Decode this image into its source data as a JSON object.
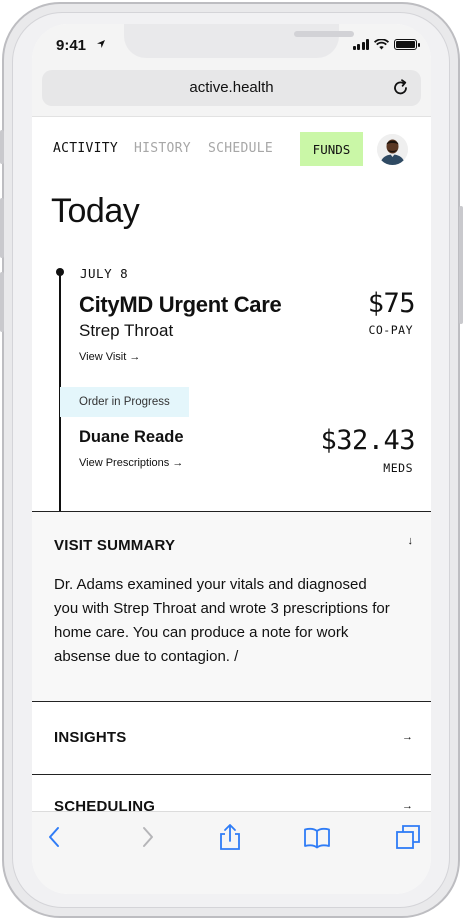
{
  "status_bar": {
    "time": "9:41"
  },
  "browser": {
    "url": "active.health"
  },
  "nav": {
    "tabs": [
      {
        "label": "ACTIVITY",
        "active": true
      },
      {
        "label": "HISTORY",
        "active": false
      },
      {
        "label": "SCHEDULE",
        "active": false
      }
    ],
    "funds_label": "FUNDS"
  },
  "page": {
    "title": "Today"
  },
  "timeline": {
    "date": "JULY 8",
    "visit": {
      "provider": "CityMD Urgent Care",
      "diagnosis": "Strep Throat",
      "link": "View Visit →",
      "amount": "$75",
      "amount_label": "CO-PAY"
    },
    "order": {
      "status": "Order in Progress",
      "pharmacy": "Duane Reade",
      "link": "View Prescriptions →",
      "amount": "$32.43",
      "amount_label": "MEDS"
    }
  },
  "sections": {
    "visit_summary": {
      "title": "VISIT SUMMARY",
      "arrow": "↓",
      "body": "Dr. Adams examined your vitals and diagnosed you with Strep Throat and wrote 3 prescriptions for home care. You can produce a note for work absense due to contagion. /"
    },
    "insights": {
      "title": "INSIGHTS",
      "arrow": "→"
    },
    "scheduling": {
      "title": "SCHEDULING",
      "arrow": "→"
    }
  },
  "colors": {
    "funds_bg": "#caf7a7",
    "badge_bg": "#e4f6fb",
    "ios_blue": "#2f7cf6"
  },
  "icons": {
    "status": [
      "location-arrow-icon",
      "signal-icon",
      "wifi-icon",
      "battery-icon"
    ],
    "browser": [
      "reload-icon",
      "back-icon",
      "forward-icon",
      "share-icon",
      "bookmarks-icon",
      "tabs-icon"
    ]
  }
}
